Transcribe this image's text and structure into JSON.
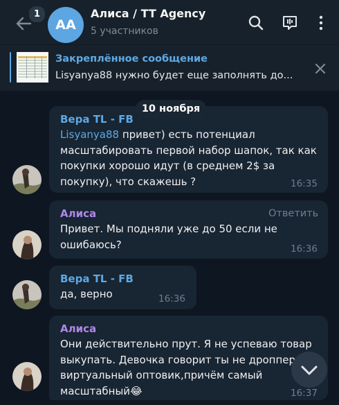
{
  "header": {
    "unread_count": "1",
    "avatar_initials": "AA",
    "title": "Алиса / TT Agency",
    "subtitle": "5 участников",
    "icons": [
      "back-arrow-icon",
      "search-icon",
      "group-call-icon",
      "more-vertical-icon"
    ]
  },
  "pinned": {
    "title": "Закреплённое сообщение",
    "text": "Lisyanya88 нужно будет еще заполнять до..."
  },
  "date_divider": "10 ноября",
  "messages": [
    {
      "sender": "Вера TL - FB",
      "sender_color": "#5ea9e4",
      "mention": "Lisyanya88",
      "text": " привет) есть потенциал\nмасштабировать первой набор шапок, так как\nпокупки хорошо идут (в среднем 2$ за\nпокупку), что скажешь ?",
      "time": "16:35"
    },
    {
      "sender": "Алиса",
      "sender_color": "#b087e8",
      "reply_label": "Ответить",
      "text": "Привет. Мы подняли уже до 50 если не\nошибаюсь?",
      "time": "16:36"
    },
    {
      "sender": "Вера TL - FB",
      "sender_color": "#5ea9e4",
      "text": "да, верно",
      "time": "16:36"
    },
    {
      "sender": "Алиса",
      "sender_color": "#b087e8",
      "text": "Они действительно прут. Я не успеваю товар\nвыкупать. Девочка говорит ты не дроппер а\nвиртуальный оптовик,причём самый\nмасштабный",
      "emoji": "😂",
      "time": "16:37"
    }
  ],
  "scroll_icon": "chevron-down-icon",
  "colors": {
    "background": "#0e1621",
    "header": "#17212b",
    "bubble": "#182533",
    "accent": "#5ea9e4"
  }
}
